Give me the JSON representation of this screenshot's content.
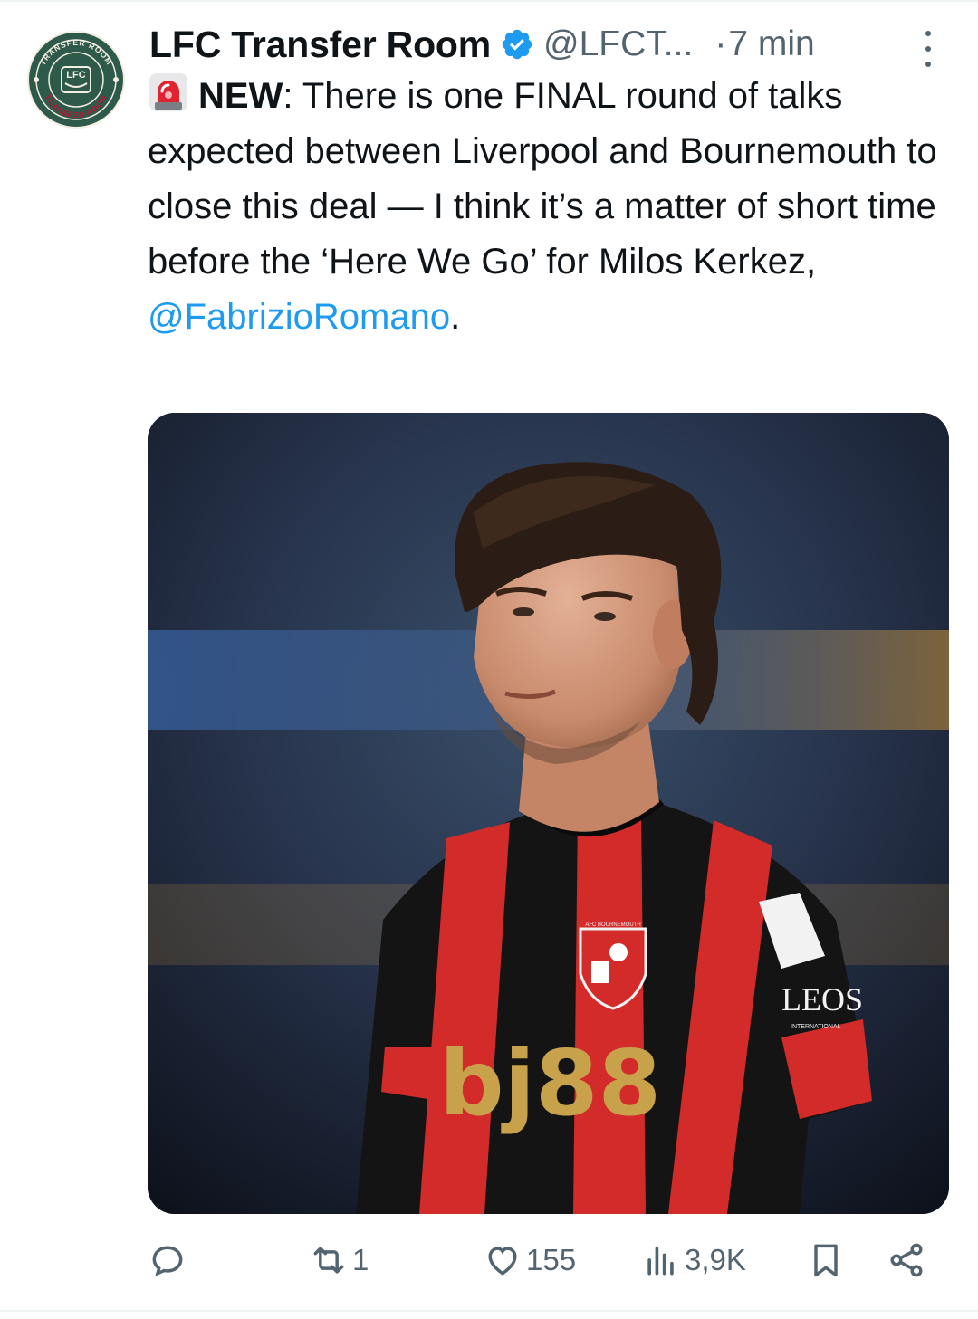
{
  "tweet": {
    "display_name": "LFC Transfer Room",
    "handle": "@LFCT...",
    "separator": "·",
    "time": "7 min",
    "text_label": "NEW",
    "text_body": ": There is one FINAL round of talks expected between Liverpool and Bournemouth to close this deal — I think it’s a matter of short time before the ‘Here We Go’ for Milos Kerkez,",
    "mention": "@FabrizioRomano",
    "text_end": ".",
    "avatar_text_top": "TRANSFER ROOM",
    "avatar_text_bottom": "TRANSFER ROOM",
    "avatar_crest": "LFC"
  },
  "media": {
    "shirt_sponsor": "bj88",
    "sleeve_sponsor": "LEOS",
    "sleeve_sponsor_sub": "INTERNATIONAL",
    "crest_text": "AFC BOURNEMOUTH"
  },
  "actions": {
    "reply_count": "",
    "retweet_count": "1",
    "like_count": "155",
    "views_count": "3,9K"
  },
  "colors": {
    "text": "#0f1419",
    "secondary": "#536471",
    "link": "#1d9bf0",
    "verified": "#1d9bf0",
    "avatar_green": "#2d5a4a",
    "avatar_red": "#c8102e"
  },
  "icons": [
    "siren-icon",
    "verified-badge-icon",
    "more-icon",
    "reply-icon",
    "retweet-icon",
    "like-icon",
    "views-icon",
    "bookmark-icon",
    "share-icon"
  ]
}
